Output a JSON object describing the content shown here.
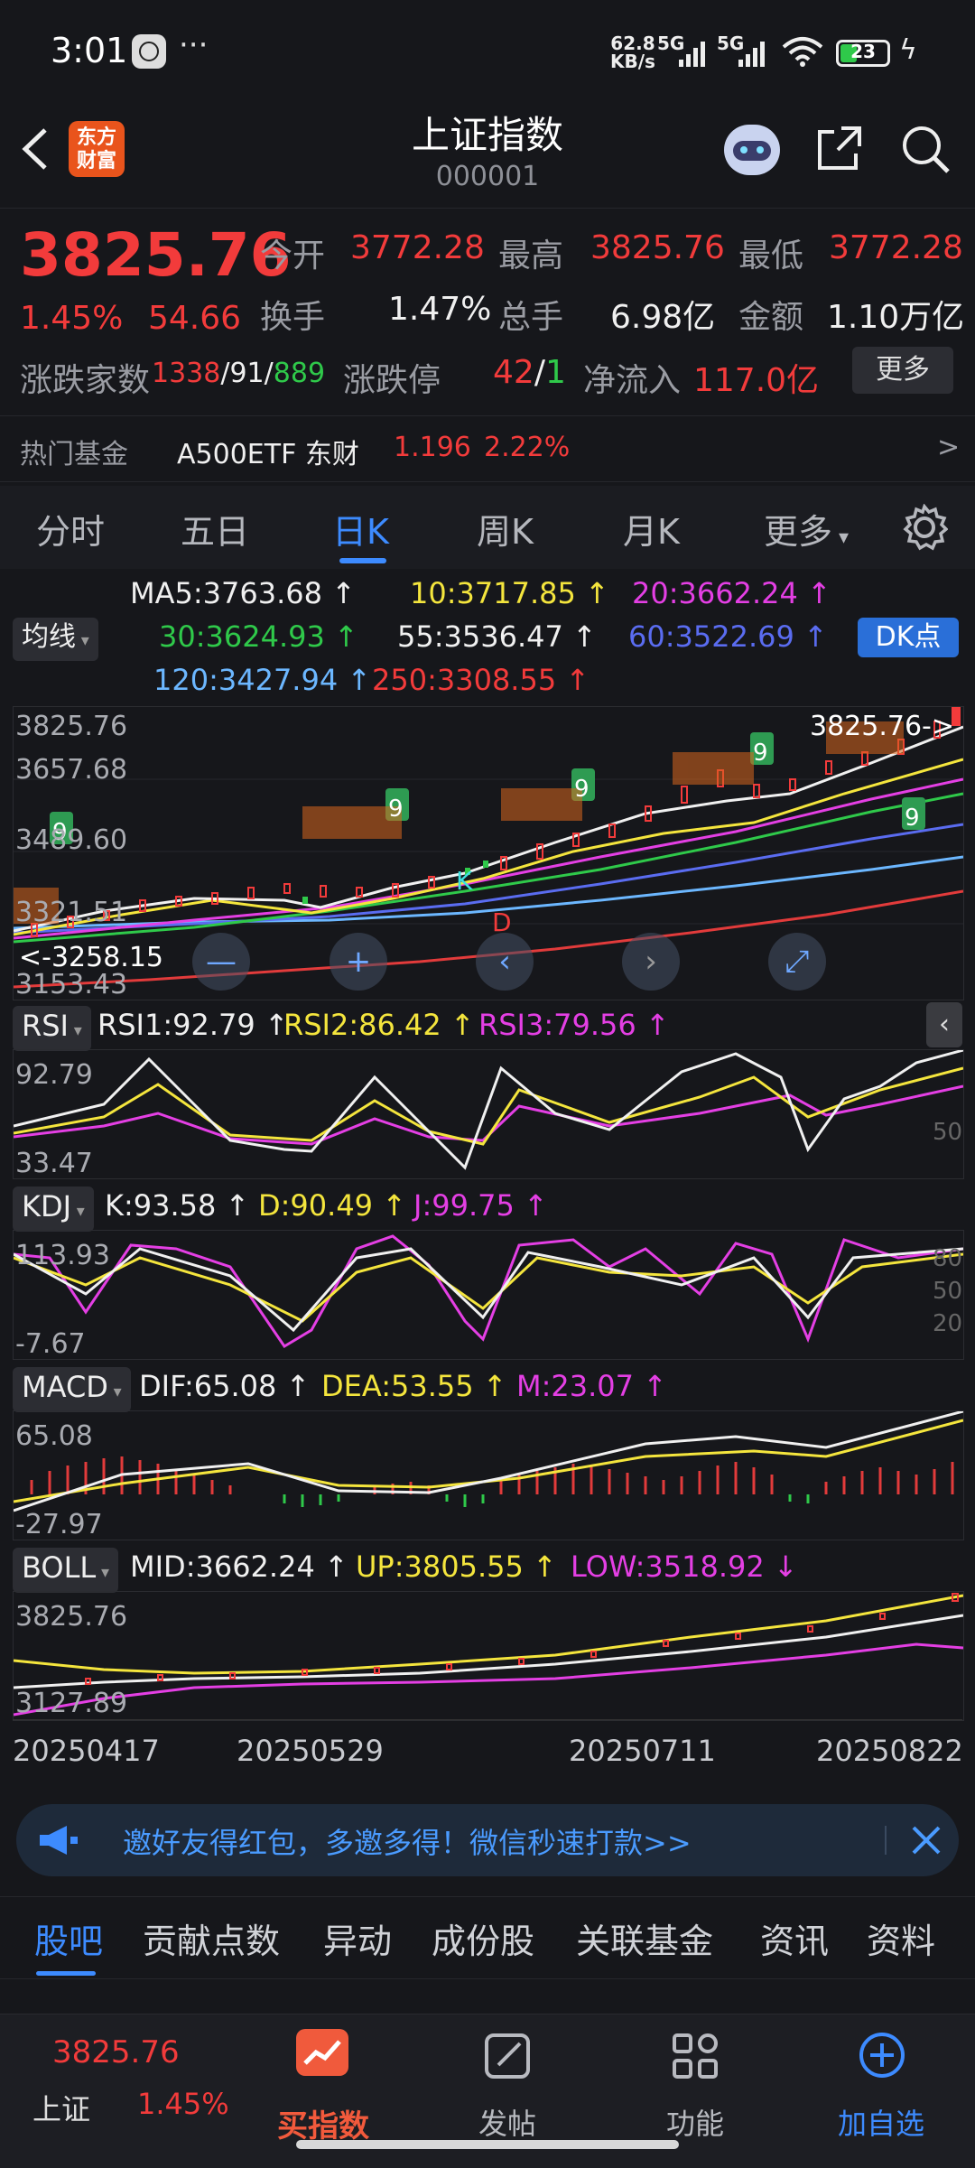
{
  "status_bar": {
    "time": "3:01",
    "net_speed": "62.8",
    "net_unit": "KB/s",
    "sim1": "5G",
    "sim2": "5G",
    "battery": "23"
  },
  "header": {
    "title": "上证指数",
    "code": "000001",
    "logo_text_1": "东方",
    "logo_text_2": "财富"
  },
  "quote": {
    "price": "3825.76",
    "change_pct": "1.45%",
    "change_val": "54.66",
    "open_label": "今开",
    "open": "3772.28",
    "high_label": "最高",
    "high": "3825.76",
    "low_label": "最低",
    "low": "3772.28",
    "turnover_label": "换手",
    "turnover": "1.47%",
    "volume_label": "总手",
    "volume": "6.98亿",
    "amount_label": "金额",
    "amount": "1.10万亿",
    "breadth_label": "涨跌家数",
    "breadth_up": "1338",
    "breadth_flat": "91",
    "breadth_down": "889",
    "sep": "/",
    "limit_label": "涨跌停",
    "limit_up": "42",
    "limit_down": "1",
    "netflow_label": "净流入",
    "netflow": "117.0亿",
    "more": "更多"
  },
  "hot_fund": {
    "label": "热门基金",
    "name": "A500ETF 东财",
    "price": "1.196",
    "pct": "2.22%",
    "arrow": ">"
  },
  "tabs": [
    "分时",
    "五日",
    "日K",
    "周K",
    "月K",
    "更多"
  ],
  "active_tab": "日K",
  "ma": {
    "ma5": "MA5:3763.68 ↑",
    "ma10": "10:3717.85 ↑",
    "ma20": "20:3662.24 ↑",
    "ma30": "30:3624.93 ↑",
    "ma55": "55:3536.47 ↑",
    "ma60": "60:3522.69 ↑",
    "ma120": "120:3427.94 ↑",
    "ma250": "250:3308.55 ↑",
    "selector": "均线",
    "dk": "DK点"
  },
  "kline": {
    "y_labels": [
      "3825.76",
      "3657.68",
      "3489.60",
      "3321.51",
      "3153.43"
    ],
    "last_price_tag": "3825.76->",
    "min_tag": "<-3258.15",
    "marker_k": "K",
    "marker_d": "D",
    "nine": "9"
  },
  "rsi": {
    "name": "RSI",
    "rsi1": "RSI1:92.79 ↑",
    "rsi2": "RSI2:86.42 ↑",
    "rsi3": "RSI3:79.56 ↑",
    "y_top": "92.79",
    "y_bottom": "33.47",
    "ref": "50"
  },
  "kdj": {
    "name": "KDJ",
    "k": "K:93.58 ↑",
    "d": "D:90.49 ↑",
    "j": "J:99.75 ↑",
    "y_top": "113.93",
    "y_bottom": "-7.67",
    "r80": "80",
    "r50": "50",
    "r20": "20"
  },
  "macd": {
    "name": "MACD",
    "dif": "DIF:65.08 ↑",
    "dea": "DEA:53.55 ↑",
    "m": "M:23.07 ↑",
    "y_top": "65.08",
    "y_bottom": "-27.97"
  },
  "boll": {
    "name": "BOLL",
    "mid": "MID:3662.24 ↑",
    "up": "UP:3805.55 ↑",
    "low": "LOW:3518.92 ↓",
    "y_top": "3825.76",
    "y_bottom": "3127.89"
  },
  "dates": [
    "20250417",
    "20250529",
    "20250711",
    "20250822"
  ],
  "promo": {
    "text": "邀好友得红包，多邀多得！微信秒速打款>>"
  },
  "bottom_tabs": [
    "股吧",
    "贡献点数",
    "异动",
    "成份股",
    "关联基金",
    "资讯",
    "资料"
  ],
  "nav": {
    "index_price": "3825.76",
    "index_name": "上证",
    "index_pct": "1.45%",
    "buy": "买指数",
    "post": "发帖",
    "func": "功能",
    "add": "加自选"
  },
  "colors": {
    "up": "#f23b3b",
    "down": "#2fc94a",
    "accent": "#3d8bff",
    "bg": "#16171b"
  }
}
